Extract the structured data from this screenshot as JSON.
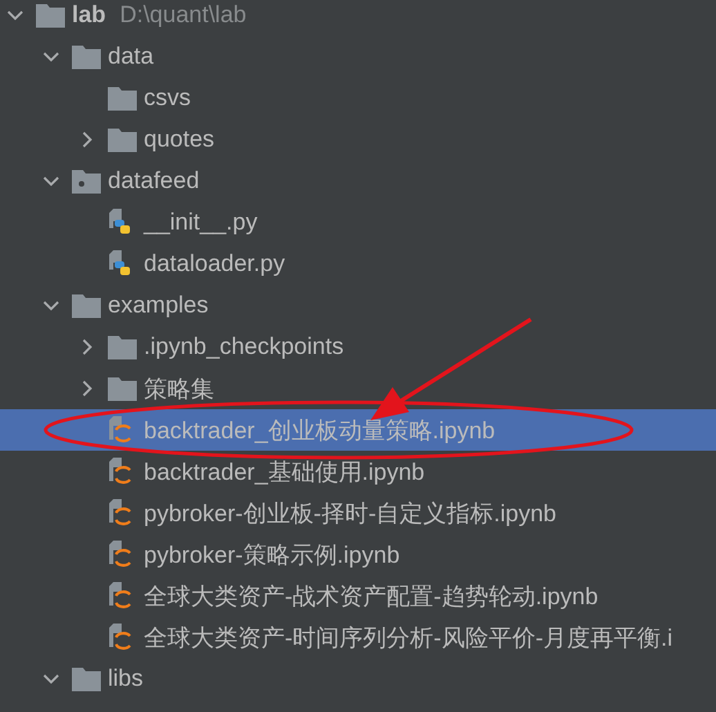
{
  "project_tree": [
    {
      "name": "lab",
      "path": "D:\\quant\\lab",
      "kind": "folder",
      "expanded": true,
      "selected": false,
      "children": [
        {
          "name": "data",
          "kind": "folder",
          "expanded": true,
          "selected": false,
          "children": [
            {
              "name": "csvs",
              "kind": "folder",
              "selected": false
            },
            {
              "name": "quotes",
              "kind": "folder",
              "expanded": false,
              "selected": false
            }
          ]
        },
        {
          "name": "datafeed",
          "kind": "package",
          "expanded": true,
          "selected": false,
          "children": [
            {
              "name": "__init__.py",
              "kind": "python",
              "selected": false
            },
            {
              "name": "dataloader.py",
              "kind": "python",
              "selected": false
            }
          ]
        },
        {
          "name": "examples",
          "kind": "folder",
          "expanded": true,
          "selected": false,
          "children": [
            {
              "name": ".ipynb_checkpoints",
              "kind": "folder",
              "expanded": false,
              "selected": false
            },
            {
              "name": "策略集",
              "kind": "folder",
              "expanded": false,
              "selected": false
            },
            {
              "name": "backtrader_创业板动量策略.ipynb",
              "kind": "notebook",
              "selected": true
            },
            {
              "name": "backtrader_基础使用.ipynb",
              "kind": "notebook",
              "selected": false
            },
            {
              "name": "pybroker-创业板-择时-自定义指标.ipynb",
              "kind": "notebook",
              "selected": false
            },
            {
              "name": "pybroker-策略示例.ipynb",
              "kind": "notebook",
              "selected": false
            },
            {
              "name": "全球大类资产-战术资产配置-趋势轮动.ipynb",
              "kind": "notebook",
              "selected": false
            },
            {
              "name": "全球大类资产-时间序列分析-风险平价-月度再平衡.i",
              "kind": "notebook",
              "selected": false
            }
          ]
        },
        {
          "name": "libs",
          "kind": "folder",
          "expanded": true,
          "selected": false
        }
      ]
    }
  ],
  "annotations": [
    {
      "kind": "ellipse"
    },
    {
      "kind": "arrow"
    }
  ]
}
